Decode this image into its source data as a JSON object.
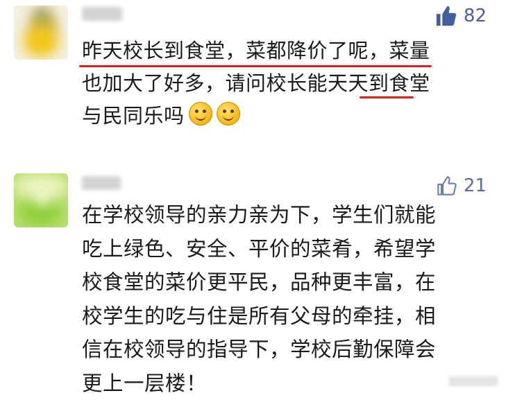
{
  "comments": [
    {
      "likes": "82",
      "liked": true,
      "lines": [
        "昨天校长到食堂，菜都降价了呢，菜量",
        "也加大了好多，请问校长能天天到食堂",
        "与民同乐吗"
      ],
      "emojis": [
        "smile-emoji",
        "smile-emoji"
      ]
    },
    {
      "likes": "21",
      "liked": false,
      "lines": [
        "在学校领导的亲力亲为下，学生们就能",
        "吃上绿色、安全、平价的菜肴，希望学",
        "校食堂的菜价更平民，品种更丰富，在",
        "校学生的吃与住是所有父母的牵挂，相",
        "信在校领导的指导下，学校后勤保障会",
        "更上一层楼！"
      ]
    }
  ],
  "colors": {
    "like_filled": "#3f5f9f",
    "like_outline": "#6c7fa8",
    "underline": "#e21d1d"
  }
}
